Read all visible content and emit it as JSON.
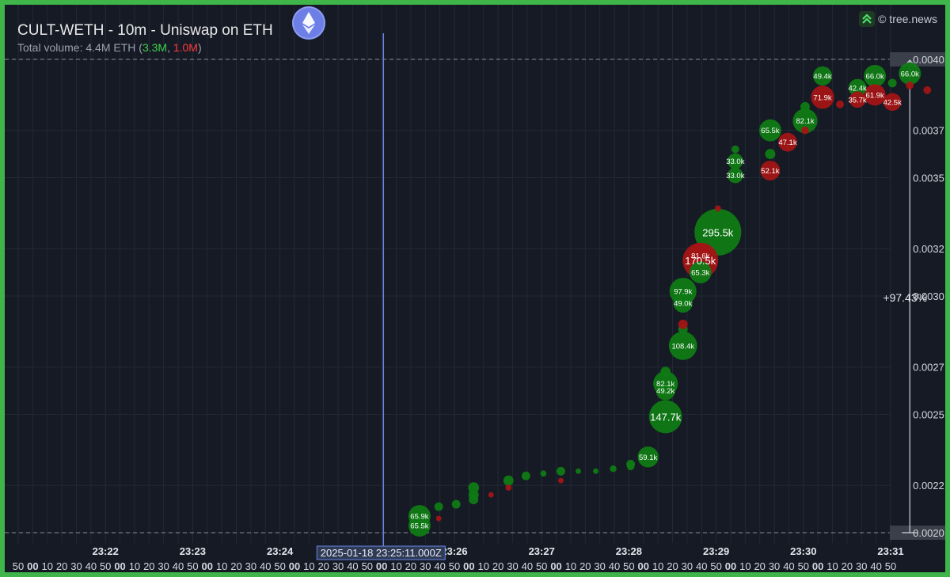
{
  "header": {
    "title": "CULT-WETH - 10m - Uniswap on ETH",
    "volume_prefix": "Total volume: 4.4M ETH (",
    "volume_buy": "3.3M",
    "volume_sep": ", ",
    "volume_sell": "1.0M",
    "volume_suffix": ")"
  },
  "brand": {
    "label": "© tree.news",
    "icon": "tree-news-arrow-icon"
  },
  "event_marker": {
    "icon": "ethereum-logo-icon",
    "timestamp": "2025-01-18 23:25:11.000Z"
  },
  "colors": {
    "background": "#161a25",
    "buy": "#0f7a14",
    "sell": "#a31515",
    "grid": "#2c313d",
    "marker_line": "#6a86e8"
  },
  "chart_data": {
    "type": "scatter",
    "x_unit": "time (minute index, 23:21 = 0)",
    "y_unit": "price (ETH)",
    "xlim": [
      0,
      10
    ],
    "ylim": [
      0.00198,
      0.00406
    ],
    "y_ticks": [
      "0.0040",
      "0.0037",
      "0.0035",
      "0.0032",
      "0.0030",
      "0.0027",
      "0.0025",
      "0.0022",
      "0.0020"
    ],
    "y_tick_values": [
      0.004,
      0.0037,
      0.0035,
      0.0032,
      0.003,
      0.0027,
      0.0025,
      0.0022,
      0.002
    ],
    "x_major_ticks": [
      "23:22",
      "23:23",
      "23:24",
      "23:25",
      "23:26",
      "23:27",
      "23:28",
      "23:29",
      "23:30",
      "23:31"
    ],
    "x_major_values": [
      1,
      2,
      3,
      4,
      5,
      6,
      7,
      8,
      9,
      10
    ],
    "x_second_labels": [
      "50",
      "00",
      "10",
      "20",
      "30",
      "40"
    ],
    "price_range": {
      "low": 0.002,
      "high": 0.004,
      "change_label": "+97.43%"
    },
    "event_x": 4.186,
    "trades": [
      {
        "t": 4.6,
        "p": 0.00203,
        "vol": 65.5,
        "side": "buy",
        "label": "65.5k"
      },
      {
        "t": 4.6,
        "p": 0.00207,
        "vol": 65.9,
        "side": "buy",
        "label": "65.9k"
      },
      {
        "t": 4.6,
        "p": 0.00205,
        "vol": 20,
        "side": "buy"
      },
      {
        "t": 4.82,
        "p": 0.00211,
        "vol": 10,
        "side": "buy"
      },
      {
        "t": 4.82,
        "p": 0.00206,
        "vol": 4,
        "side": "sell"
      },
      {
        "t": 5.02,
        "p": 0.00212,
        "vol": 10,
        "side": "buy"
      },
      {
        "t": 5.22,
        "p": 0.00216,
        "vol": 14,
        "side": "buy"
      },
      {
        "t": 5.22,
        "p": 0.00219,
        "vol": 16,
        "side": "buy"
      },
      {
        "t": 5.22,
        "p": 0.00214,
        "vol": 12,
        "side": "buy"
      },
      {
        "t": 5.42,
        "p": 0.00216,
        "vol": 4,
        "side": "sell"
      },
      {
        "t": 5.62,
        "p": 0.00222,
        "vol": 14,
        "side": "buy"
      },
      {
        "t": 5.62,
        "p": 0.00219,
        "vol": 5,
        "side": "sell"
      },
      {
        "t": 5.82,
        "p": 0.00224,
        "vol": 10,
        "side": "buy"
      },
      {
        "t": 6.02,
        "p": 0.00225,
        "vol": 5,
        "side": "buy"
      },
      {
        "t": 6.22,
        "p": 0.00226,
        "vol": 10,
        "side": "buy"
      },
      {
        "t": 6.22,
        "p": 0.00222,
        "vol": 4,
        "side": "sell"
      },
      {
        "t": 6.42,
        "p": 0.00226,
        "vol": 4,
        "side": "buy"
      },
      {
        "t": 6.62,
        "p": 0.00226,
        "vol": 4,
        "side": "buy"
      },
      {
        "t": 6.82,
        "p": 0.00227,
        "vol": 6,
        "side": "buy"
      },
      {
        "t": 7.02,
        "p": 0.00229,
        "vol": 10,
        "side": "buy"
      },
      {
        "t": 7.02,
        "p": 0.00228,
        "vol": 8,
        "side": "buy"
      },
      {
        "t": 7.22,
        "p": 0.00232,
        "vol": 59.1,
        "side": "buy",
        "label": "59.1k"
      },
      {
        "t": 7.42,
        "p": 0.00249,
        "vol": 147.7,
        "side": "buy",
        "label": "147.7k"
      },
      {
        "t": 7.42,
        "p": 0.0026,
        "vol": 49.2,
        "side": "buy",
        "label": "49.2k"
      },
      {
        "t": 7.42,
        "p": 0.00263,
        "vol": 82.1,
        "side": "buy",
        "label": "82.1k"
      },
      {
        "t": 7.42,
        "p": 0.00268,
        "vol": 14,
        "side": "buy"
      },
      {
        "t": 7.62,
        "p": 0.00279,
        "vol": 108.4,
        "side": "buy",
        "label": "108.4k"
      },
      {
        "t": 7.62,
        "p": 0.00286,
        "vol": 12,
        "side": "buy"
      },
      {
        "t": 7.62,
        "p": 0.00288,
        "vol": 12,
        "side": "sell"
      },
      {
        "t": 7.62,
        "p": 0.00297,
        "vol": 49.0,
        "side": "buy",
        "label": "49.0k"
      },
      {
        "t": 7.62,
        "p": 0.00302,
        "vol": 97.9,
        "side": "buy",
        "label": "97.9k"
      },
      {
        "t": 7.82,
        "p": 0.0031,
        "vol": 65.3,
        "side": "buy",
        "label": "65.3k"
      },
      {
        "t": 7.82,
        "p": 0.00315,
        "vol": 170.5,
        "side": "sell",
        "label": "170.5k"
      },
      {
        "t": 7.82,
        "p": 0.00317,
        "vol": 81.6,
        "side": "sell",
        "label": "81.6k"
      },
      {
        "t": 8.02,
        "p": 0.00327,
        "vol": 295.5,
        "side": "buy",
        "label": "295.5k"
      },
      {
        "t": 8.02,
        "p": 0.00337,
        "vol": 5,
        "side": "sell"
      },
      {
        "t": 8.22,
        "p": 0.00351,
        "vol": 33.0,
        "side": "buy",
        "label": "33.0k"
      },
      {
        "t": 8.22,
        "p": 0.00357,
        "vol": 33.0,
        "side": "buy",
        "label": "33.0k"
      },
      {
        "t": 8.22,
        "p": 0.00362,
        "vol": 8,
        "side": "buy"
      },
      {
        "t": 8.62,
        "p": 0.0036,
        "vol": 14,
        "side": "buy"
      },
      {
        "t": 8.62,
        "p": 0.00353,
        "vol": 52.1,
        "side": "sell",
        "label": "52.1k"
      },
      {
        "t": 8.62,
        "p": 0.0037,
        "vol": 65.5,
        "side": "buy",
        "label": "65.5k"
      },
      {
        "t": 8.82,
        "p": 0.00365,
        "vol": 47.1,
        "side": "sell",
        "label": "47.1k"
      },
      {
        "t": 9.02,
        "p": 0.00374,
        "vol": 82.1,
        "side": "buy",
        "label": "82.1k"
      },
      {
        "t": 9.02,
        "p": 0.0038,
        "vol": 12,
        "side": "buy"
      },
      {
        "t": 9.02,
        "p": 0.0037,
        "vol": 8,
        "side": "sell"
      },
      {
        "t": 9.22,
        "p": 0.00384,
        "vol": 71.9,
        "side": "sell",
        "label": "71.9k"
      },
      {
        "t": 9.22,
        "p": 0.00393,
        "vol": 49.4,
        "side": "buy",
        "label": "49.4k"
      },
      {
        "t": 9.42,
        "p": 0.00381,
        "vol": 8,
        "side": "sell"
      },
      {
        "t": 9.62,
        "p": 0.00383,
        "vol": 35.7,
        "side": "sell",
        "label": "35.7k"
      },
      {
        "t": 9.62,
        "p": 0.00388,
        "vol": 42.4,
        "side": "buy",
        "label": "42.4k"
      },
      {
        "t": 9.82,
        "p": 0.00385,
        "vol": 61.9,
        "side": "sell",
        "label": "61.9k"
      },
      {
        "t": 9.82,
        "p": 0.00393,
        "vol": 66.0,
        "side": "buy",
        "label": "66.0k"
      },
      {
        "t": 10.02,
        "p": 0.00382,
        "vol": 42.5,
        "side": "sell",
        "label": "42.5k"
      },
      {
        "t": 10.02,
        "p": 0.0039,
        "vol": 10,
        "side": "buy"
      },
      {
        "t": 10.22,
        "p": 0.00394,
        "vol": 66.0,
        "side": "buy",
        "label": "66.0k"
      },
      {
        "t": 10.22,
        "p": 0.00389,
        "vol": 8,
        "side": "sell"
      },
      {
        "t": 10.42,
        "p": 0.00387,
        "vol": 8,
        "side": "sell"
      }
    ]
  }
}
